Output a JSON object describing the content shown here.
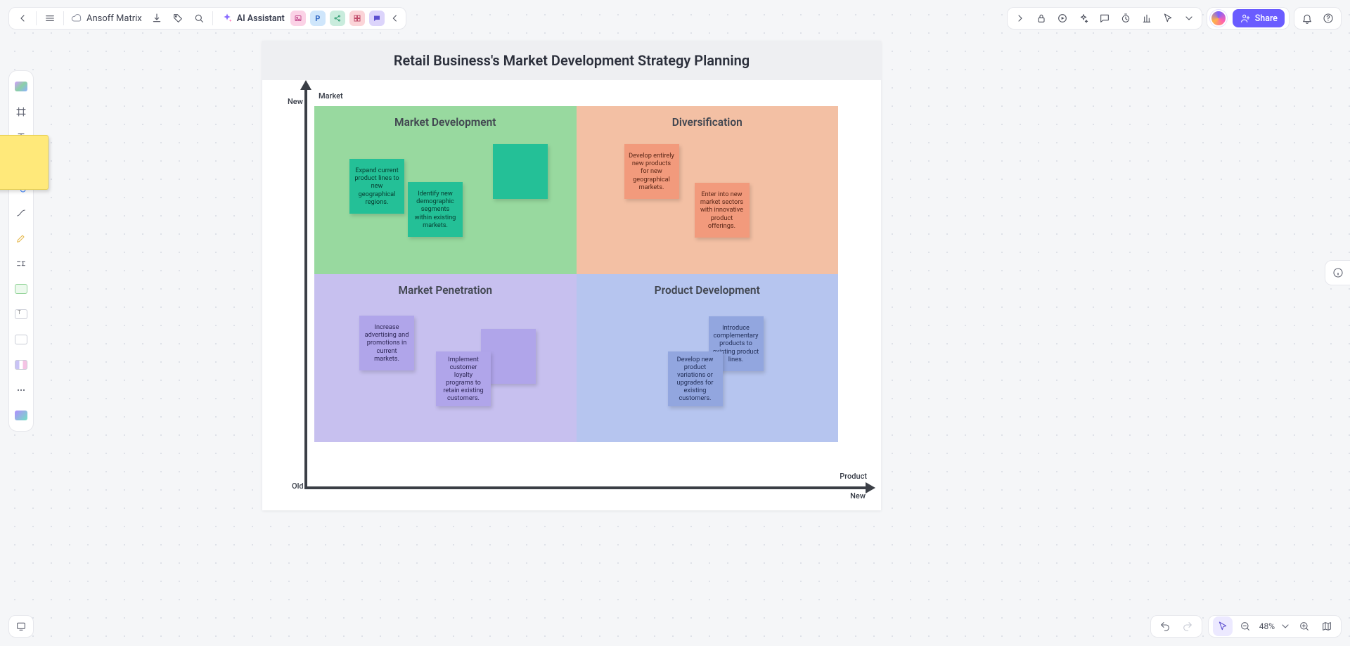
{
  "top_left": {
    "doc_title": "Ansoff Matrix",
    "ai_assistant": "AI Assistant"
  },
  "top_right": {
    "share": "Share"
  },
  "bottom_right": {
    "zoom": "48%"
  },
  "diagram": {
    "title": "Retail Business's Market Development Strategy Planning",
    "axes": {
      "y_label": "Market",
      "x_label": "Product",
      "new_y": "New",
      "old": "Old",
      "new_x": "New"
    },
    "quadrants": {
      "md": {
        "title": "Market Development",
        "s1": "Expand current product lines to new geographical regions.",
        "s2": "Identify new demographic segments within existing markets."
      },
      "dv": {
        "title": "Diversification",
        "s1": "Develop entirely new products for new geographical markets.",
        "s2": "Enter into new market sectors with innovative product offerings."
      },
      "mp": {
        "title": "Market Penetration",
        "s1": "Increase advertising and promotions in current markets.",
        "s2": "Implement customer loyalty programs to retain existing customers."
      },
      "pd": {
        "title": "Product Development",
        "s1": "Introduce complementary products to existing product lines.",
        "s2": "Develop new product variations or upgrades for existing customers."
      }
    }
  },
  "chart_data": {
    "type": "matrix",
    "title": "Retail Business's Market Development Strategy Planning",
    "framework": "Ansoff Matrix",
    "x_axis": {
      "label": "Product",
      "low": "Old",
      "high": "New"
    },
    "y_axis": {
      "label": "Market",
      "low": "Old",
      "high": "New"
    },
    "cells": [
      {
        "x": "Old",
        "y": "New",
        "name": "Market Development",
        "notes": [
          "Expand current product lines to new geographical regions.",
          "Identify new demographic segments within existing markets."
        ]
      },
      {
        "x": "New",
        "y": "New",
        "name": "Diversification",
        "notes": [
          "Develop entirely new products for new geographical markets.",
          "Enter into new market sectors with innovative product offerings."
        ]
      },
      {
        "x": "Old",
        "y": "Old",
        "name": "Market Penetration",
        "notes": [
          "Increase advertising and promotions in current markets.",
          "Implement customer loyalty programs to retain existing customers."
        ]
      },
      {
        "x": "New",
        "y": "Old",
        "name": "Product Development",
        "notes": [
          "Introduce complementary products to existing product lines.",
          "Develop new product variations or upgrades for existing customers."
        ]
      }
    ]
  }
}
